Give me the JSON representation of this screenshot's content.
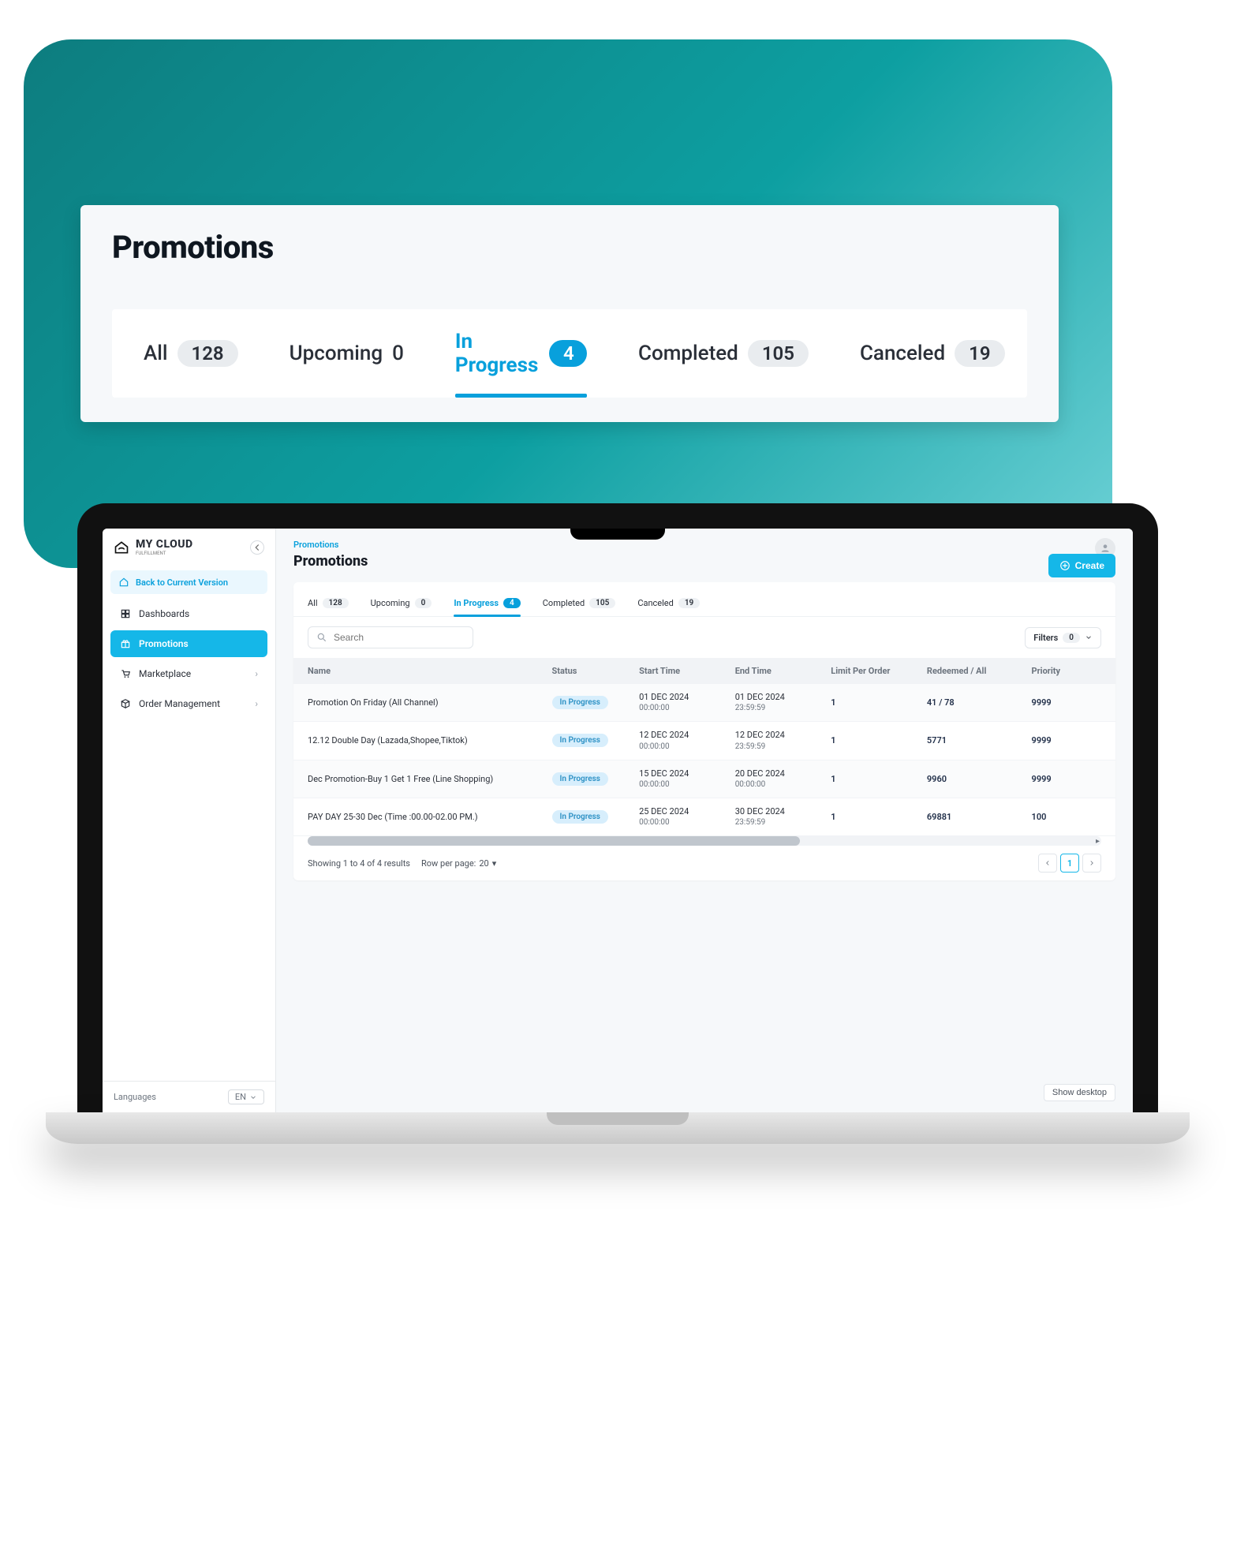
{
  "hero": {
    "title": "Promotions",
    "tabs": [
      {
        "label": "All",
        "count": "128"
      },
      {
        "label": "Upcoming",
        "count": "0",
        "plain": true
      },
      {
        "label": "In Progress",
        "count": "4",
        "active": true
      },
      {
        "label": "Completed",
        "count": "105"
      },
      {
        "label": "Canceled",
        "count": "19"
      }
    ]
  },
  "app": {
    "logo": {
      "main": "MY CLOUD",
      "sub": "FULFILLMENT"
    },
    "back_label": "Back to Current Version",
    "nav": [
      {
        "label": "Dashboards"
      },
      {
        "label": "Promotions",
        "active": true
      },
      {
        "label": "Marketplace",
        "has_children": true
      },
      {
        "label": "Order Management",
        "has_children": true
      }
    ],
    "languages_label": "Languages",
    "language_value": "EN",
    "breadcrumb": "Promotions",
    "page_title": "Promotions",
    "create_label": "Create",
    "tabs": [
      {
        "label": "All",
        "count": "128"
      },
      {
        "label": "Upcoming",
        "count": "0"
      },
      {
        "label": "In Progress",
        "count": "4",
        "active": true
      },
      {
        "label": "Completed",
        "count": "105"
      },
      {
        "label": "Canceled",
        "count": "19"
      }
    ],
    "search_placeholder": "Search",
    "filters_label": "Filters",
    "filters_count": "0",
    "columns": {
      "name": "Name",
      "status": "Status",
      "start": "Start Time",
      "end": "End Time",
      "limit": "Limit Per Order",
      "redeemed": "Redeemed / All",
      "priority": "Priority"
    },
    "rows": [
      {
        "name": "Promotion On Friday (All Channel)",
        "status": "In Progress",
        "start_d": "01 DEC 2024",
        "start_t": "00:00:00",
        "end_d": "01 DEC 2024",
        "end_t": "23:59:59",
        "limit": "1",
        "redeemed": "41 / 78",
        "priority": "9999"
      },
      {
        "name": "12.12 Double Day (Lazada,Shopee,Tiktok)",
        "status": "In Progress",
        "start_d": "12 DEC 2024",
        "start_t": "00:00:00",
        "end_d": "12 DEC 2024",
        "end_t": "23:59:59",
        "limit": "1",
        "redeemed": "5771",
        "priority": "9999"
      },
      {
        "name": "Dec Promotion-Buy 1 Get 1 Free (Line Shopping)",
        "status": "In Progress",
        "start_d": "15 DEC 2024",
        "start_t": "00:00:00",
        "end_d": "20 DEC 2024",
        "end_t": "00:00:00",
        "limit": "1",
        "redeemed": "9960",
        "priority": "9999"
      },
      {
        "name": "PAY DAY 25-30 Dec (Time :00.00-02.00 PM.)",
        "status": "In Progress",
        "start_d": "25 DEC 2024",
        "start_t": "00:00:00",
        "end_d": "30 DEC 2024",
        "end_t": "23:59:59",
        "limit": "1",
        "redeemed": "69881",
        "priority": "100"
      }
    ],
    "results_text": "Showing 1 to 4 of 4 results",
    "rows_per_page_label": "Row per page:",
    "rows_per_page_value": "20",
    "page_current": "1",
    "show_desktop_label": "Show desktop"
  }
}
